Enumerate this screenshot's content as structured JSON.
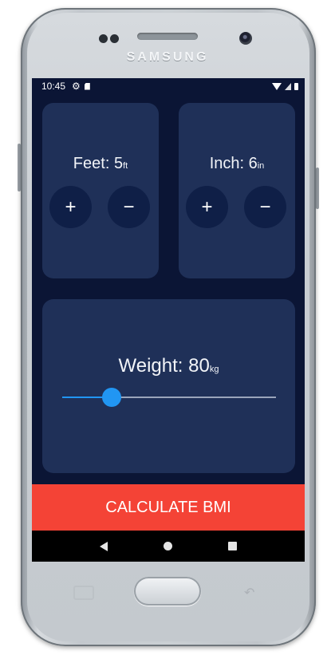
{
  "device": {
    "brand": "SAMSUNG"
  },
  "status_bar": {
    "time": "10:45",
    "icons_left": [
      "gear-icon",
      "sd-card-icon"
    ],
    "icons_right": [
      "wifi-icon",
      "signal-icon",
      "battery-icon"
    ]
  },
  "height_feet": {
    "label": "Feet: ",
    "value": "5",
    "unit": "ft",
    "increment_label": "+",
    "decrement_label": "−"
  },
  "height_inch": {
    "label": "Inch: ",
    "value": "6",
    "unit": "in",
    "increment_label": "+",
    "decrement_label": "−"
  },
  "weight": {
    "label": "Weight: ",
    "value": "80",
    "unit": "kg",
    "slider_fraction": 0.23
  },
  "calculate_button": {
    "label": "CALCULATE BMI"
  },
  "nav_bar": {
    "icons": [
      "back-icon",
      "home-icon",
      "recent-apps-icon"
    ]
  },
  "colors": {
    "background": "#0b1535",
    "card": "#1f3058",
    "round_button": "#0f1f47",
    "accent": "#2196f3",
    "calculate": "#f44336"
  }
}
